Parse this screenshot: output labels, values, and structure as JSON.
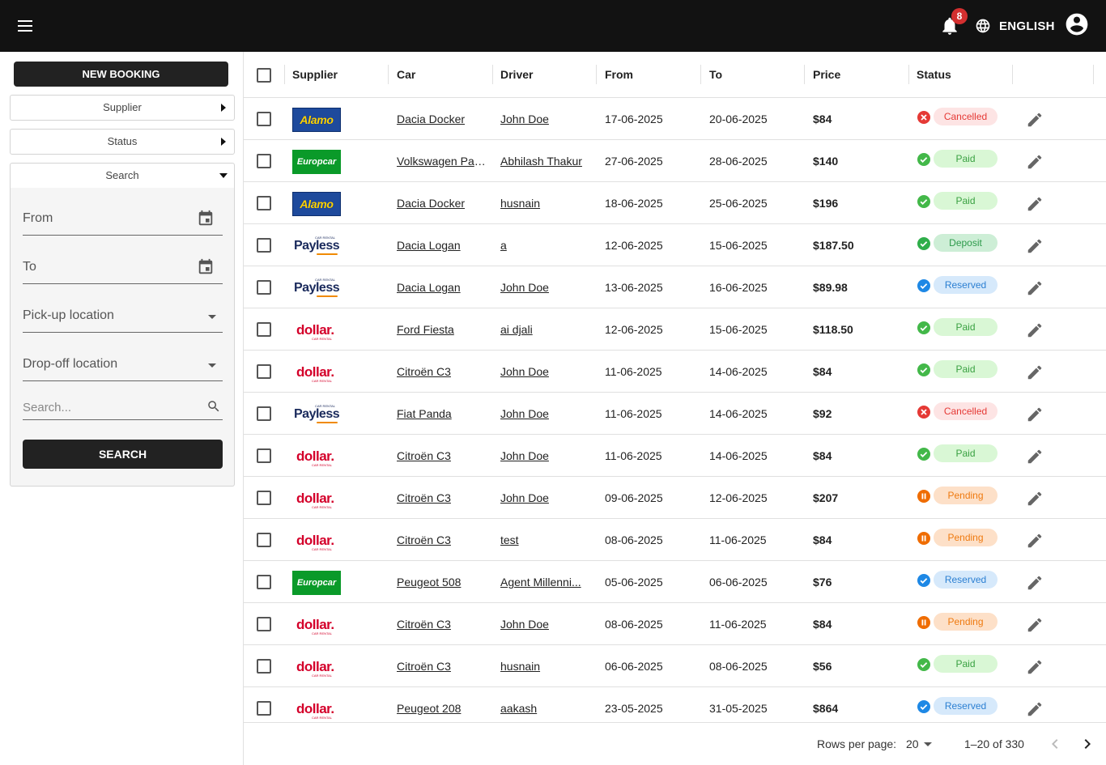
{
  "topbar": {
    "notification_count": "8",
    "language": "ENGLISH"
  },
  "sidebar": {
    "new_booking_label": "NEW BOOKING",
    "supplier_label": "Supplier",
    "status_label": "Status",
    "search_section_label": "Search",
    "from_label": "From",
    "to_label": "To",
    "pickup_label": "Pick-up location",
    "dropoff_label": "Drop-off location",
    "search_placeholder": "Search...",
    "search_button_label": "SEARCH"
  },
  "table": {
    "columns": [
      "Supplier",
      "Car",
      "Driver",
      "From",
      "To",
      "Price",
      "Status"
    ],
    "rows": [
      {
        "supplier": "Alamo",
        "car": "Dacia Docker",
        "driver": "John Doe",
        "from": "17-06-2025",
        "to": "20-06-2025",
        "price": "$84",
        "status": "Cancelled"
      },
      {
        "supplier": "Europcar",
        "car": "Volkswagen Pas...",
        "driver": "Abhilash Thakur",
        "from": "27-06-2025",
        "to": "28-06-2025",
        "price": "$140",
        "status": "Paid"
      },
      {
        "supplier": "Alamo",
        "car": "Dacia Docker",
        "driver": "husnain",
        "from": "18-06-2025",
        "to": "25-06-2025",
        "price": "$196",
        "status": "Paid"
      },
      {
        "supplier": "Payless",
        "car": "Dacia Logan",
        "driver": "a",
        "from": "12-06-2025",
        "to": "15-06-2025",
        "price": "$187.50",
        "status": "Deposit"
      },
      {
        "supplier": "Payless",
        "car": "Dacia Logan",
        "driver": "John Doe",
        "from": "13-06-2025",
        "to": "16-06-2025",
        "price": "$89.98",
        "status": "Reserved"
      },
      {
        "supplier": "Dollar",
        "car": "Ford Fiesta",
        "driver": "ai djali",
        "from": "12-06-2025",
        "to": "15-06-2025",
        "price": "$118.50",
        "status": "Paid"
      },
      {
        "supplier": "Dollar",
        "car": "Citroën C3",
        "driver": "John Doe",
        "from": "11-06-2025",
        "to": "14-06-2025",
        "price": "$84",
        "status": "Paid"
      },
      {
        "supplier": "Payless",
        "car": "Fiat Panda",
        "driver": "John Doe",
        "from": "11-06-2025",
        "to": "14-06-2025",
        "price": "$92",
        "status": "Cancelled"
      },
      {
        "supplier": "Dollar",
        "car": "Citroën C3",
        "driver": "John Doe",
        "from": "11-06-2025",
        "to": "14-06-2025",
        "price": "$84",
        "status": "Paid"
      },
      {
        "supplier": "Dollar",
        "car": "Citroën C3",
        "driver": "John Doe",
        "from": "09-06-2025",
        "to": "12-06-2025",
        "price": "$207",
        "status": "Pending"
      },
      {
        "supplier": "Dollar",
        "car": "Citroën C3",
        "driver": "test",
        "from": "08-06-2025",
        "to": "11-06-2025",
        "price": "$84",
        "status": "Pending"
      },
      {
        "supplier": "Europcar",
        "car": "Peugeot 508",
        "driver": "Agent Millenni...",
        "from": "05-06-2025",
        "to": "06-06-2025",
        "price": "$76",
        "status": "Reserved"
      },
      {
        "supplier": "Dollar",
        "car": "Citroën C3",
        "driver": "John Doe",
        "from": "08-06-2025",
        "to": "11-06-2025",
        "price": "$84",
        "status": "Pending"
      },
      {
        "supplier": "Dollar",
        "car": "Citroën C3",
        "driver": "husnain",
        "from": "06-06-2025",
        "to": "08-06-2025",
        "price": "$56",
        "status": "Paid"
      },
      {
        "supplier": "Dollar",
        "car": "Peugeot 208",
        "driver": "aakash",
        "from": "23-05-2025",
        "to": "31-05-2025",
        "price": "$864",
        "status": "Reserved"
      }
    ]
  },
  "logos": {
    "Alamo": {
      "text": "Alamo",
      "bg": "#1e4a9c",
      "fg": "#ffd200"
    },
    "Europcar": {
      "text": "Europcar",
      "bg": "#0a9a29",
      "fg": "#ffffff"
    },
    "Payless": {
      "text": "Payless",
      "sub": "CAR RENTAL",
      "fg": "#1a2a5c",
      "accent": "#f08a00"
    },
    "Dollar": {
      "text": "dollar.",
      "sub": "CAR RENTAL",
      "fg": "#d4002a"
    }
  },
  "status_styles": {
    "Cancelled": {
      "icon_color": "#e53935",
      "pill_bg": "#fde4e4",
      "pill_fg": "#e53935",
      "icon": "x"
    },
    "Paid": {
      "icon_color": "#43b849",
      "pill_bg": "#d9f7d5",
      "pill_fg": "#3aa142",
      "icon": "check"
    },
    "Deposit": {
      "icon_color": "#2fae4a",
      "pill_bg": "#cdeed6",
      "pill_fg": "#2d9a4b",
      "icon": "check"
    },
    "Reserved": {
      "icon_color": "#1e88e5",
      "pill_bg": "#d6e9fb",
      "pill_fg": "#2b7fd2",
      "icon": "check"
    },
    "Pending": {
      "icon_color": "#ef6c00",
      "pill_bg": "#fde0c8",
      "pill_fg": "#ef7a10",
      "icon": "pause"
    }
  },
  "pagination": {
    "rows_per_page_label": "Rows per page:",
    "rows_per_page_value": "20",
    "range_label": "1–20 of 330"
  }
}
